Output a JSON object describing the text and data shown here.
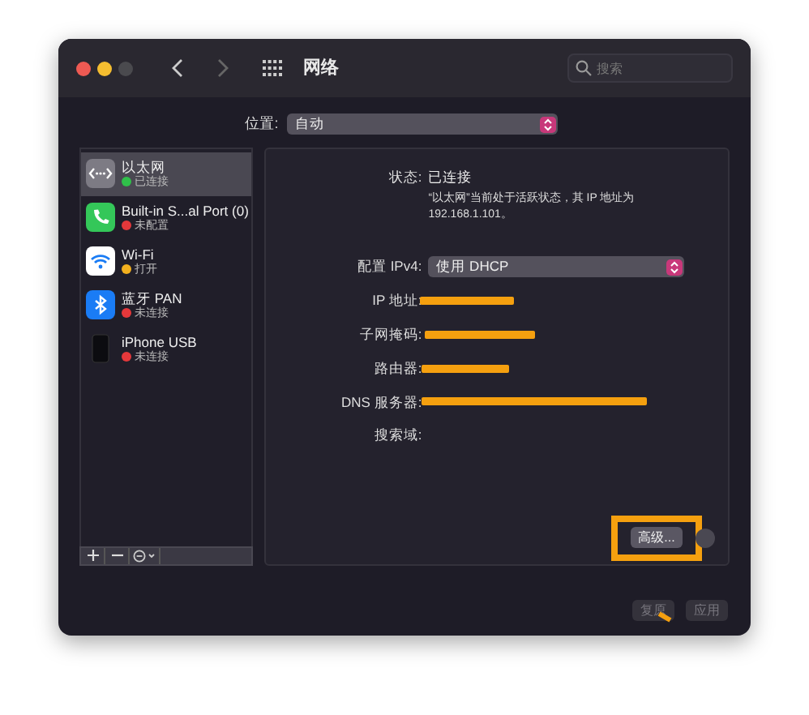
{
  "window": {
    "title": "网络",
    "search_placeholder": "搜索"
  },
  "location": {
    "label": "位置:",
    "value": "自动"
  },
  "services": [
    {
      "name": "以太网",
      "status": "已连接",
      "color": "#30c04a",
      "kind": "ethernet",
      "selected": true
    },
    {
      "name": "Built-in S...al Port (0)",
      "status": "未配置",
      "color": "#e5383b",
      "kind": "phone",
      "selected": false
    },
    {
      "name": "Wi-Fi",
      "status": "打开",
      "color": "#f2b01e",
      "kind": "wifi",
      "selected": false
    },
    {
      "name": "蓝牙 PAN",
      "status": "未连接",
      "color": "#e5383b",
      "kind": "bluetooth",
      "selected": false
    },
    {
      "name": "iPhone USB",
      "status": "未连接",
      "color": "#e5383b",
      "kind": "iphone",
      "selected": false
    }
  ],
  "detail": {
    "status_label": "状态:",
    "status_value": "已连接",
    "status_note": "“以太网”当前处于活跃状态，其 IP 地址为 192.168.1.101。",
    "configure_label": "配置 IPv4:",
    "configure_value": "使用 DHCP",
    "fields": [
      {
        "label": "IP 地址:",
        "redacted": true
      },
      {
        "label": "子网掩码:",
        "redacted": true
      },
      {
        "label": "路由器:",
        "redacted": true
      },
      {
        "label": "DNS 服务器:",
        "redacted": true
      },
      {
        "label": "搜索域:",
        "redacted": false
      }
    ]
  },
  "advanced_button": {
    "label": "高级...",
    "highlighted": true
  },
  "buttons": [
    {
      "label": "复原",
      "disabled": true,
      "marked": true
    },
    {
      "label": "应用",
      "disabled": true,
      "marked": false
    }
  ]
}
